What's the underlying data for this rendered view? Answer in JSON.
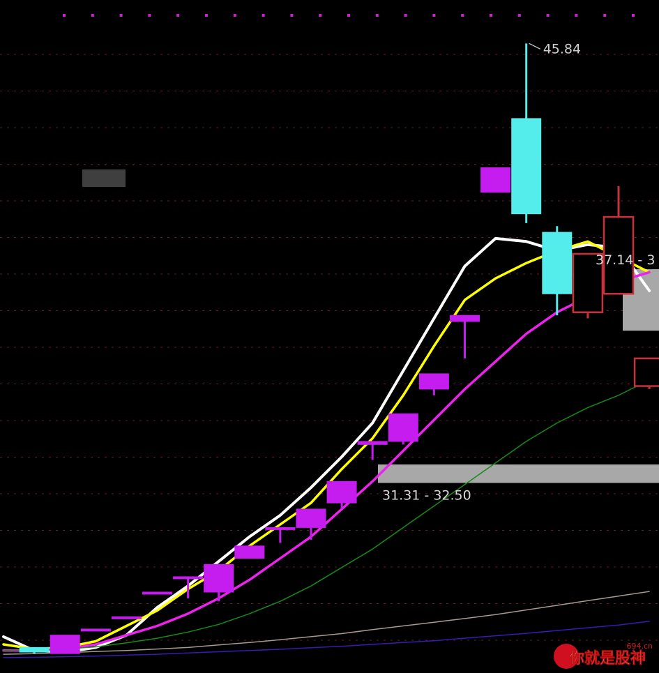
{
  "chart_data": {
    "type": "candlestick",
    "ylim": [
      25.8,
      46.8
    ],
    "grid": true,
    "candles": [
      {
        "open": 26.2,
        "high": 26.2,
        "low": 26.0,
        "close": 26.05,
        "color": "#55ECEC"
      },
      {
        "open": 26.0,
        "high": 26.6,
        "low": 26.0,
        "close": 26.6,
        "color": "#C51CF0"
      },
      {
        "open": 26.8,
        "high": 26.8,
        "low": 26.8,
        "close": 26.8,
        "color": "#C51CF0"
      },
      {
        "open": 27.2,
        "high": 27.2,
        "low": 27.2,
        "close": 27.2,
        "color": "#C51CF0"
      },
      {
        "open": 28.0,
        "high": 28.0,
        "low": 28.0,
        "close": 28.0,
        "color": "#C51CF0"
      },
      {
        "open": 28.5,
        "high": 28.5,
        "low": 27.8,
        "close": 28.5,
        "color": "#C51CF0"
      },
      {
        "open": 28.0,
        "high": 28.9,
        "low": 27.7,
        "close": 28.9,
        "color": "#C51CF0"
      },
      {
        "open": 29.1,
        "high": 29.5,
        "low": 29.1,
        "close": 29.5,
        "color": "#C51CF0"
      },
      {
        "open": 30.1,
        "high": 30.1,
        "low": 29.6,
        "close": 30.1,
        "color": "#C51CF0"
      },
      {
        "open": 30.1,
        "high": 30.7,
        "low": 29.7,
        "close": 30.7,
        "color": "#C51CF0"
      },
      {
        "open": 30.9,
        "high": 31.6,
        "low": 30.7,
        "close": 31.6,
        "color": "#C51CF0"
      },
      {
        "open": 32.8,
        "high": 32.9,
        "low": 32.3,
        "close": 32.9,
        "color": "#C51CF0"
      },
      {
        "open": 32.9,
        "high": 33.8,
        "low": 32.8,
        "close": 33.8,
        "color": "#C51CF0"
      },
      {
        "open": 34.6,
        "high": 35.1,
        "low": 34.4,
        "close": 35.1,
        "color": "#C51CF0"
      },
      {
        "open": 36.8,
        "high": 37.0,
        "low": 35.6,
        "close": 37.0,
        "color": "#C51CF0"
      },
      {
        "open": 41.0,
        "high": 41.8,
        "low": 41.0,
        "close": 41.8,
        "color": "#C51CF0"
      },
      {
        "open": 43.4,
        "high": 45.84,
        "low": 40.0,
        "close": 40.3,
        "color": "#55ECEC"
      },
      {
        "open": 39.7,
        "high": 39.9,
        "low": 37.0,
        "close": 37.7,
        "color": "#55ECEC"
      },
      {
        "open": 37.1,
        "high": 39.0,
        "low": 36.9,
        "close": 39.0,
        "color": "#C9313B"
      },
      {
        "open": 37.7,
        "high": 41.2,
        "low": 37.7,
        "close": 40.2,
        "color": "#C9313B"
      },
      {
        "open": 34.7,
        "high": 35.6,
        "low": 34.6,
        "close": 35.6,
        "color": "#C9313B"
      }
    ],
    "series": [
      {
        "color": "#FFFFFF",
        "y": [
          26.55,
          26.1,
          26.05,
          26.2,
          26.6,
          27.5,
          28.2,
          29.0,
          29.8,
          30.5,
          31.4,
          32.4,
          33.5,
          35.2,
          36.9,
          38.6,
          39.5,
          39.4,
          39.1,
          39.3,
          39.2,
          37.8
        ]
      },
      {
        "color": "#FFFF00",
        "y": [
          26.3,
          26.15,
          26.2,
          26.4,
          26.9,
          27.4,
          28.1,
          28.7,
          29.5,
          30.2,
          30.9,
          32.0,
          33.0,
          34.4,
          36.0,
          37.5,
          38.2,
          38.7,
          39.1,
          39.4,
          38.9,
          38.4
        ]
      },
      {
        "color": "#EE22EE",
        "y": [
          26.1,
          26.1,
          26.15,
          26.3,
          26.6,
          26.9,
          27.3,
          27.8,
          28.4,
          29.1,
          29.8,
          30.7,
          31.6,
          32.6,
          33.6,
          34.6,
          35.5,
          36.4,
          37.1,
          37.6,
          38.1,
          38.4
        ]
      },
      {
        "color": "#168C16",
        "y": [
          26.1,
          26.12,
          26.15,
          26.22,
          26.35,
          26.5,
          26.7,
          26.95,
          27.3,
          27.7,
          28.2,
          28.8,
          29.4,
          30.1,
          30.8,
          31.5,
          32.2,
          32.9,
          33.5,
          34.0,
          34.4,
          34.9
        ]
      },
      {
        "color": "#A89890",
        "y": [
          25.98,
          26.0,
          26.03,
          26.07,
          26.1,
          26.15,
          26.2,
          26.28,
          26.36,
          26.45,
          26.55,
          26.65,
          26.78,
          26.9,
          27.02,
          27.14,
          27.27,
          27.42,
          27.57,
          27.72,
          27.87,
          28.02
        ]
      },
      {
        "color": "#3A1AB0",
        "y": [
          25.87,
          25.88,
          25.9,
          25.92,
          25.95,
          25.98,
          26.02,
          26.06,
          26.1,
          26.14,
          26.19,
          26.24,
          26.3,
          26.36,
          26.42,
          26.5,
          26.58,
          26.66,
          26.75,
          26.84,
          26.93,
          27.05
        ]
      }
    ],
    "zones": [
      {
        "low": 31.55,
        "high": 32.15,
        "label": "31.31 - 32.50"
      },
      {
        "low": 37.9,
        "high": 38.5,
        "label": "37.14 - 3"
      }
    ],
    "peak_label": "45.84"
  },
  "watermark": {
    "domain": "694.cn",
    "brand": "你就是股神"
  }
}
